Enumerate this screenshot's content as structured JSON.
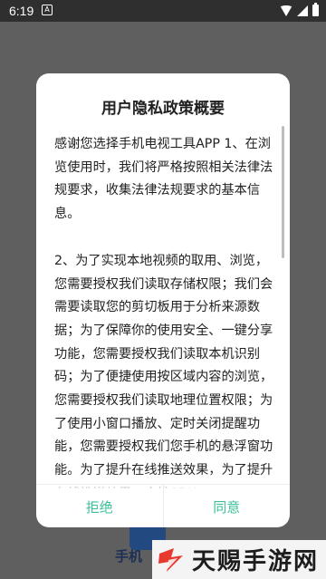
{
  "status_bar": {
    "time": "6:19",
    "notification_icon": "A"
  },
  "background_app": {
    "label": "手机"
  },
  "dialog": {
    "title": "用户隐私政策概要",
    "paragraph1": "感谢您选择手机电视工具APP 1、在浏览使用时，我们将严格按照相关法律法规要求，收集法律法规要求的基本信息。",
    "paragraph2": "2、为了实现本地视频的取用、浏览，您需要授权我们读取存储权限；我们会需要读取您的剪切板用于分析来源数据；为了保障你的使用安全、一键分享功能，您需要授权我们读取本机识别码；为了便捷使用按区域内容的浏览，您需要授权我们读取地理位置权限；为了使用小窗口播放、定时关闭提醒功能，您需要授权我们您手机的悬浮窗功能。为了提升在线推送效果，为了提升在线推送效果，个推SDK",
    "reject_label": "拒绝",
    "agree_label": "同意"
  },
  "watermark": {
    "text": "天赐手游网"
  },
  "colors": {
    "accent": "#3cc09a",
    "overlay": "#5f5f5f",
    "watermark_logo": "#e8392f"
  }
}
